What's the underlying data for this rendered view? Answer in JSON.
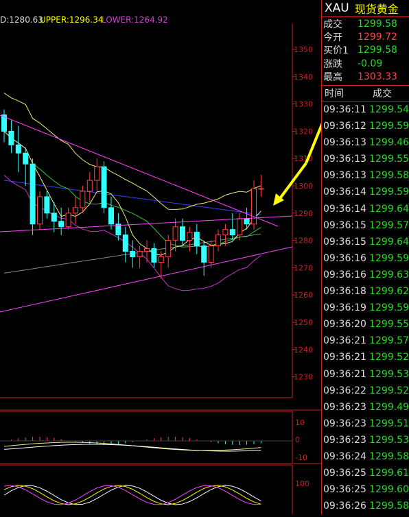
{
  "indicator_header": {
    "mid": "D:1280.63",
    "upper": "UPPER:1296.34",
    "lower": "LOWER:1264.92"
  },
  "price_axis": [
    "1350",
    "1340",
    "1330",
    "1320",
    "1310",
    "1300",
    "1290",
    "1280",
    "1270",
    "1260",
    "1250",
    "1240",
    "1230"
  ],
  "macd_axis": [
    "10",
    "0",
    "-10"
  ],
  "kdj_axis": [
    "100"
  ],
  "colors": {
    "up_candle": "#ff4444",
    "down_candle": "#33ffff",
    "grid": "#cc2222",
    "upper_lower_band": "#cc33cc",
    "trendline": "#ff44ff",
    "ma_blue": "#3344ff",
    "ma_green": "#33cc33",
    "ma_yellow": "#eeee88",
    "annotation_arrow": "#ffff00"
  },
  "candles": [
    [
      1326,
      1328,
      1316,
      1320
    ],
    [
      1320,
      1324,
      1312,
      1315
    ],
    [
      1315,
      1322,
      1305,
      1312
    ],
    [
      1312,
      1314,
      1300,
      1308
    ],
    [
      1308,
      1310,
      1282,
      1286
    ],
    [
      1286,
      1298,
      1284,
      1296
    ],
    [
      1296,
      1298,
      1288,
      1290
    ],
    [
      1290,
      1294,
      1283,
      1287
    ],
    [
      1287,
      1292,
      1282,
      1285
    ],
    [
      1285,
      1292,
      1284,
      1290
    ],
    [
      1290,
      1296,
      1286,
      1292
    ],
    [
      1292,
      1300,
      1290,
      1298
    ],
    [
      1298,
      1305,
      1294,
      1302
    ],
    [
      1302,
      1310,
      1298,
      1307
    ],
    [
      1307,
      1309,
      1290,
      1292
    ],
    [
      1292,
      1296,
      1284,
      1286
    ],
    [
      1286,
      1290,
      1280,
      1282
    ],
    [
      1282,
      1285,
      1272,
      1276
    ],
    [
      1276,
      1280,
      1270,
      1274
    ],
    [
      1274,
      1278,
      1270,
      1276
    ],
    [
      1276,
      1280,
      1272,
      1277
    ],
    [
      1277,
      1279,
      1270,
      1272
    ],
    [
      1272,
      1276,
      1266,
      1274
    ],
    [
      1274,
      1282,
      1270,
      1280
    ],
    [
      1280,
      1288,
      1276,
      1285
    ],
    [
      1285,
      1288,
      1278,
      1280
    ],
    [
      1280,
      1285,
      1276,
      1283
    ],
    [
      1283,
      1286,
      1275,
      1278
    ],
    [
      1278,
      1280,
      1267,
      1272
    ],
    [
      1272,
      1280,
      1270,
      1278
    ],
    [
      1278,
      1284,
      1276,
      1282
    ],
    [
      1282,
      1286,
      1278,
      1284
    ],
    [
      1284,
      1290,
      1280,
      1282
    ],
    [
      1282,
      1290,
      1280,
      1288
    ],
    [
      1288,
      1292,
      1284,
      1286
    ],
    [
      1286,
      1302,
      1284,
      1299
    ],
    [
      1299,
      1304,
      1296,
      1299
    ]
  ],
  "quote": {
    "code": "XAU",
    "name": "现货黄金",
    "rows": [
      {
        "label": "成交",
        "value": "1299.58",
        "color": "#22dd22"
      },
      {
        "label": "今开",
        "value": "1299.72",
        "color": "#ff4444"
      },
      {
        "label": "买价1",
        "value": "1299.58",
        "color": "#22dd22"
      },
      {
        "label": "涨跌",
        "value": "-0.09",
        "color": "#22dd22"
      },
      {
        "label": "最高",
        "value": "1303.33",
        "color": "#ff4444"
      }
    ]
  },
  "ticks_header": {
    "time": "时间",
    "price": "成交"
  },
  "ticks": [
    {
      "time": "09:36:11",
      "price": "1299.54"
    },
    {
      "time": "09:36:12",
      "price": "1299.59"
    },
    {
      "time": "09:36:13",
      "price": "1299.46"
    },
    {
      "time": "09:36:13",
      "price": "1299.55"
    },
    {
      "time": "09:36:13",
      "price": "1299.58"
    },
    {
      "time": "09:36:14",
      "price": "1299.59"
    },
    {
      "time": "09:36:14",
      "price": "1299.64"
    },
    {
      "time": "09:36:15",
      "price": "1299.57"
    },
    {
      "time": "09:36:15",
      "price": "1299.64"
    },
    {
      "time": "09:36:16",
      "price": "1299.59"
    },
    {
      "time": "09:36:16",
      "price": "1299.63"
    },
    {
      "time": "09:36:18",
      "price": "1299.62"
    },
    {
      "time": "09:36:19",
      "price": "1299.59"
    },
    {
      "time": "09:36:20",
      "price": "1299.55"
    },
    {
      "time": "09:36:21",
      "price": "1299.57"
    },
    {
      "time": "09:36:21",
      "price": "1299.52"
    },
    {
      "time": "09:36:21",
      "price": "1299.53"
    },
    {
      "time": "09:36:22",
      "price": "1299.52"
    },
    {
      "time": "09:36:23",
      "price": "1299.49"
    },
    {
      "time": "09:36:23",
      "price": "1299.51"
    },
    {
      "time": "09:36:23",
      "price": "1299.53"
    },
    {
      "time": "09:36:24",
      "price": "1299.58"
    },
    {
      "time": "09:36:25",
      "price": "1299.61"
    },
    {
      "time": "09:36:25",
      "price": "1299.60"
    },
    {
      "time": "09:36:26",
      "price": "1299.58"
    }
  ]
}
